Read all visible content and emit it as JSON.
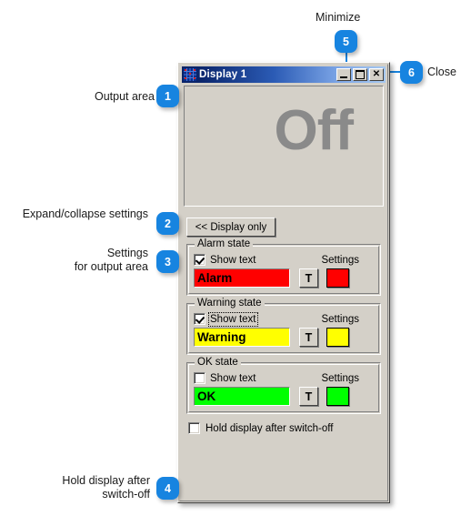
{
  "annotations": [
    {
      "number": "1",
      "label": "Output area"
    },
    {
      "number": "2",
      "label": "Expand/collapse settings"
    },
    {
      "number": "3",
      "label": "Settings\nfor output area"
    },
    {
      "number": "4",
      "label": "Hold display after\nswitch-off"
    },
    {
      "number": "5",
      "label": "Minimize"
    },
    {
      "number": "6",
      "label": "Close"
    }
  ],
  "window": {
    "title": "Display 1",
    "app_icon": "grid-icon",
    "buttons": {
      "minimize": "minimize-icon",
      "maximize": "maximize-icon",
      "close": "close-icon"
    },
    "output_area": {
      "text": "Off",
      "text_color": "#8a8a8a",
      "background": "#d4d0c8"
    },
    "toggle_button": "<< Display only",
    "groups": [
      {
        "title": "Alarm state",
        "show_text_label": "Show text",
        "show_text_checked": true,
        "focused": false,
        "settings_label": "Settings",
        "preview_text": "Alarm",
        "preview_bg": "#ff0000",
        "font_button": "T",
        "swatch_color": "#ff0000"
      },
      {
        "title": "Warning state",
        "show_text_label": "Show text",
        "show_text_checked": true,
        "focused": true,
        "settings_label": "Settings",
        "preview_text": "Warning",
        "preview_bg": "#ffff00",
        "font_button": "T",
        "swatch_color": "#ffff00"
      },
      {
        "title": "OK state",
        "show_text_label": "Show text",
        "show_text_checked": false,
        "focused": false,
        "settings_label": "Settings",
        "preview_text": "OK",
        "preview_bg": "#00ff00",
        "font_button": "T",
        "swatch_color": "#00ff00"
      }
    ],
    "hold_display": {
      "label": "Hold display after switch-off",
      "checked": false
    }
  },
  "colors": {
    "badge": "#1784e0",
    "leader": "#1784e0",
    "window_face": "#d4d0c8",
    "title_start": "#0a246a",
    "title_end": "#a6c8f0"
  }
}
